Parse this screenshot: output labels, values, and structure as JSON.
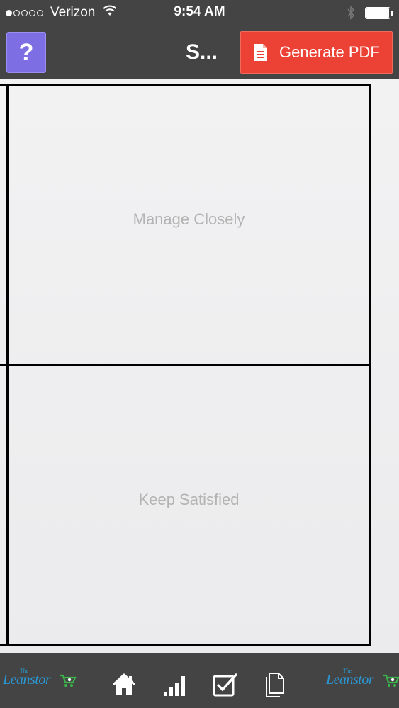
{
  "status_bar": {
    "carrier": "Verizon",
    "time": "9:54 AM",
    "signal_bars_filled": 1,
    "signal_bars_total": 5
  },
  "nav": {
    "help_label": "?",
    "title": "S...",
    "generate_pdf_label": "Generate PDF"
  },
  "matrix": {
    "quadrants": [
      {
        "label": "Manage Closely"
      },
      {
        "label": "Keep Satisfied"
      }
    ]
  },
  "tab_bar": {
    "logo_small": "The",
    "logo_text": "Leanstor",
    "tabs": [
      {
        "name": "home",
        "icon": "home-icon"
      },
      {
        "name": "chart",
        "icon": "bar-chart-icon"
      },
      {
        "name": "checklist",
        "icon": "checkbox-icon"
      },
      {
        "name": "documents",
        "icon": "document-icon"
      }
    ]
  },
  "colors": {
    "bar_background": "#444444",
    "help_button": "#7d6ee4",
    "pdf_button": "#ec4135",
    "quadrant_text": "#b3b3b3",
    "logo_blue": "#2a97d4",
    "logo_green": "#3bb54a"
  }
}
